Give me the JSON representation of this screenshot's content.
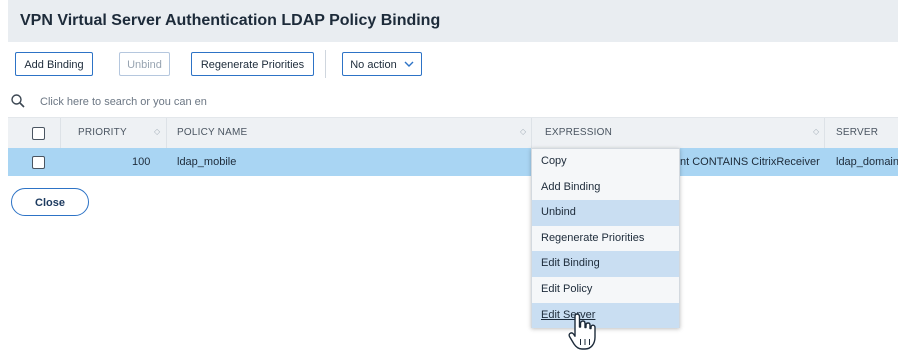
{
  "header": {
    "title": "VPN Virtual Server Authentication LDAP Policy Binding"
  },
  "toolbar": {
    "add_binding": "Add Binding",
    "unbind": "Unbind",
    "regenerate": "Regenerate Priorities",
    "action_select": "No action"
  },
  "search": {
    "placeholder": "Click here to search or you can en"
  },
  "table": {
    "columns": [
      "PRIORITY",
      "POLICY NAME",
      "EXPRESSION",
      "SERVER"
    ],
    "rows": [
      {
        "priority": "100",
        "policy_name": "ldap_mobile",
        "expression": "nt CONTAINS CitrixReceiver",
        "server": "ldap_domain"
      }
    ]
  },
  "close_button": "Close",
  "context_menu": {
    "items": [
      "Copy",
      "Add Binding",
      "Unbind",
      "Regenerate Priorities",
      "Edit Binding",
      "Edit Policy",
      "Edit Server"
    ]
  },
  "colors": {
    "accent": "#2d73c6",
    "selected_row": "#a9d5f3",
    "menu_highlight": "#c9def2",
    "header_bg": "#e9edf1"
  },
  "icons": [
    "search-icon",
    "chevron-down-icon",
    "sort-icon",
    "hand-pointer-icon"
  ]
}
